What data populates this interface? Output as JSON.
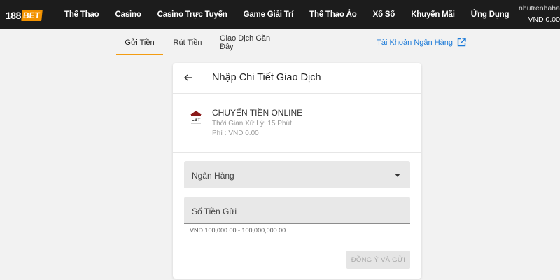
{
  "brand": {
    "logo_number": "188",
    "logo_text": "BET",
    "accent_color": "#f29200"
  },
  "nav": {
    "items": [
      {
        "label": "Thể Thao"
      },
      {
        "label": "Casino"
      },
      {
        "label": "Casino Trực Tuyến"
      },
      {
        "label": "Game Giải Trí"
      },
      {
        "label": "Thể Thao Ảo"
      },
      {
        "label": "Xổ Số"
      },
      {
        "label": "Khuyến Mãi"
      },
      {
        "label": "Ứng Dụng"
      }
    ]
  },
  "user": {
    "username": "nhutrenhaha",
    "balance": "VND 0.00"
  },
  "tabs": {
    "deposit": "Gửi Tiền",
    "withdraw": "Rút Tiền",
    "history": "Giao Dịch Gần Đây",
    "active": "deposit"
  },
  "bank_account_link": {
    "label": "Tài Khoản Ngân Hàng",
    "icon": "external-link-icon",
    "color": "#1d7bd8"
  },
  "card": {
    "title": "Nhập Chi Tiết Giao Dịch",
    "back_icon": "arrow-left-icon",
    "method": {
      "icon": "bank-icon",
      "icon_text": "LBT",
      "name": "CHUYỂN TIỀN ONLINE",
      "processing_time": "Thời Gian Xử Lý: 15 Phút",
      "fee": "Phí : VND 0.00"
    },
    "bank_field": {
      "label": "Ngân Hàng",
      "icon": "caret-down-icon"
    },
    "amount_field": {
      "label": "Số Tiền Gửi",
      "hint": "VND 100,000.00 - 100,000,000.00"
    },
    "submit_label": "ĐỒNG Ý VÀ GỬI"
  }
}
